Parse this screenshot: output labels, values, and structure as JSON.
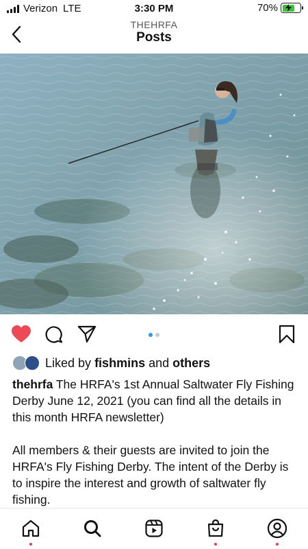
{
  "status_bar": {
    "carrier": "Verizon",
    "network": "LTE",
    "time": "3:30 PM",
    "battery_percent": "70%",
    "battery_level": 0.7,
    "battery_color": "#3cc13b"
  },
  "header": {
    "username": "THEHRFA",
    "title": "Posts",
    "back_icon": "chevron-left-icon"
  },
  "post": {
    "image_count": 2,
    "active_image": 0,
    "liked": true,
    "like_color": "#ed4956",
    "likes": {
      "prefix": "Liked by",
      "user": "fishmins",
      "conjunction": "and",
      "others": "others"
    },
    "caption": {
      "author": "thehrfa",
      "paragraph_1": "The HRFA's 1st Annual Saltwater Fly Fishing Derby June 12, 2021 (you can find all the details in this month HRFA newsletter)",
      "paragraph_2": "All members & their guests are invited to join the HRFA's Fly Fishing Derby. The intent of the Derby is to inspire the interest and growth of saltwater fly fishing."
    }
  },
  "tabbar": {
    "items": [
      "home-icon",
      "search-icon",
      "reels-icon",
      "shop-icon",
      "profile-icon"
    ],
    "indicator_color": "#ef3b52"
  }
}
